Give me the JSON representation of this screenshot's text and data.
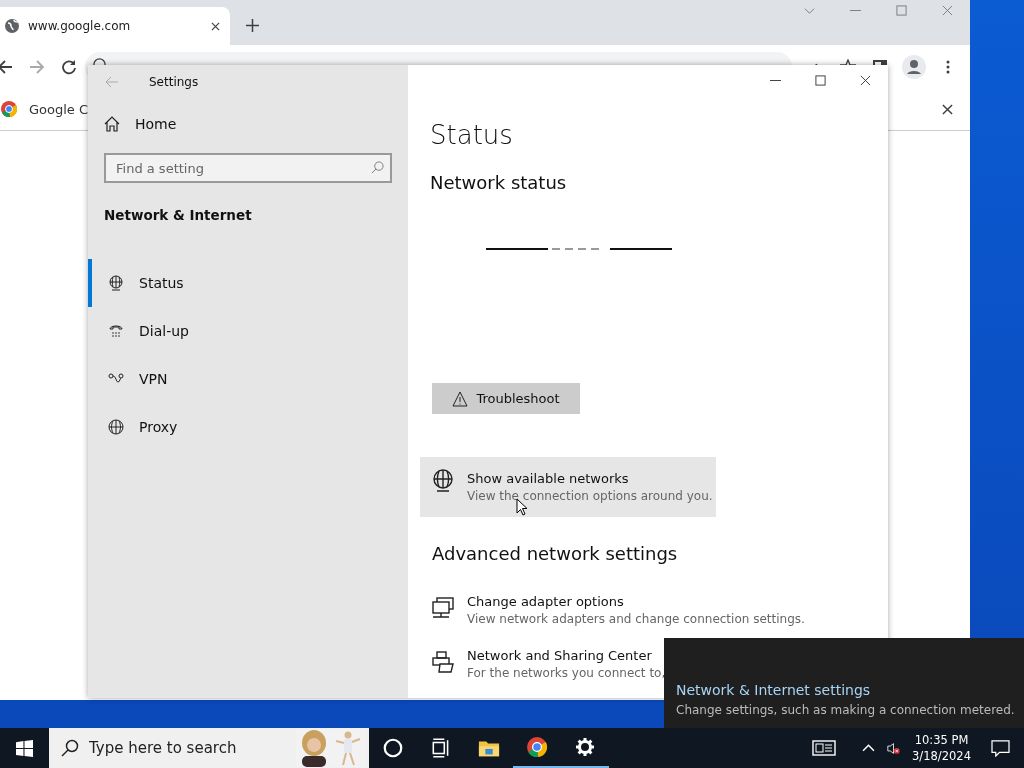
{
  "browser": {
    "tab": {
      "title": "www.google.com"
    },
    "bookmark": "Google C"
  },
  "settings": {
    "title": "Settings",
    "home": "Home",
    "search": {
      "placeholder": "Find a setting"
    },
    "section": "Network & Internet",
    "nav": [
      {
        "label": "Status",
        "selected": true
      },
      {
        "label": "Dial-up",
        "selected": false
      },
      {
        "label": "VPN",
        "selected": false
      },
      {
        "label": "Proxy",
        "selected": false
      }
    ],
    "heading": "Status",
    "subheading": "Network status",
    "troubleshoot": "Troubleshoot",
    "show_networks": {
      "title": "Show available networks",
      "description": "View the connection options around you."
    },
    "advanced_heading": "Advanced network settings",
    "links": [
      {
        "title": "Change adapter options",
        "description": "View network adapters and change connection settings."
      },
      {
        "title": "Network and Sharing Center",
        "description": "For the networks you connect to,"
      }
    ]
  },
  "flyout": {
    "title": "Network & Internet settings",
    "description": "Change settings, such as making a connection metered."
  },
  "taskbar": {
    "search": {
      "placeholder": "Type here to search"
    },
    "time": "10:35 PM",
    "date": "3/18/2024"
  }
}
